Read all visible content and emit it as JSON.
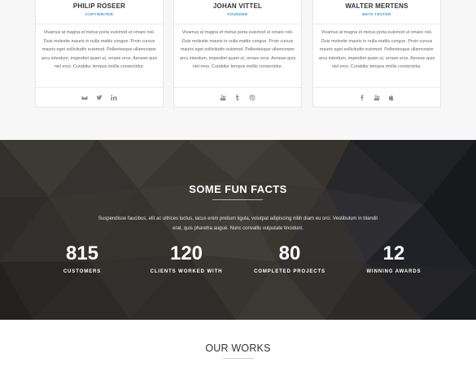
{
  "team": {
    "members": [
      {
        "name": "PHILIP ROSEER",
        "role": "COPYWRITER",
        "bio": "Vivamus at magna et metus porta euismod ut ornare nisl. Duis molestie mauris in nulla mattis congue. Proin cursus mauris eget sollicitudin euismod. Pellentesque ullamcorper arcu interdum, imperdiet quam ut, ornare eros. Aenean quis nisl eros. Curabitur tempus mollis consectetur.",
        "socials": [
          "envelope-icon",
          "twitter-icon",
          "linkedin-icon"
        ]
      },
      {
        "name": "JOHAN VITTEL",
        "role": "FOUNDER",
        "bio": "Vivamus at magna et metus porta euismod ut ornare nisl. Duis molestie mauris in nulla mattis congue. Proin cursus mauris eget sollicitudin euismod. Pellentesque ullamcorper arcu interdum, imperdiet quam ut, ornare eros. Aenean quis nisl eros. Curabitur tempus mollis consectetur.",
        "socials": [
          "youtube-icon",
          "tumblr-icon",
          "dribbble-icon"
        ]
      },
      {
        "name": "WALTER MERTENS",
        "role": "BETA TESTER",
        "bio": "Vivamus at magna et metus porta euismod ut ornare nisl. Duis molestie mauris in nulla mattis congue. Proin cursus mauris eget sollicitudin euismod. Pellentesque ullamcorper arcu interdum, imperdiet quam ut, ornare eros. Aenean quis nisl eros. Curabitur tempus mollis consectetur.",
        "socials": [
          "facebook-icon",
          "youtube-icon",
          "apple-icon"
        ]
      }
    ],
    "accent_color": "#2b9bd6"
  },
  "fun_facts": {
    "title": "SOME FUN FACTS",
    "description": "Suspendisse faucibus, elit ac ultrices luctus, lacus enim pretium ligula, volutpat adipiscing nibh diam eu orci. Vestibulum in blandit erat, quis pharetra augue. Nunc convallis vulputate tincidunt.",
    "stats": [
      {
        "value": "815",
        "label": "CUSTOMERS"
      },
      {
        "value": "120",
        "label": "CLIENTS WORKED WITH"
      },
      {
        "value": "80",
        "label": "COMPLETED PROJECTS"
      },
      {
        "value": "12",
        "label": "WINNING AWARDS"
      }
    ]
  },
  "works": {
    "title": "OUR WORKS"
  }
}
